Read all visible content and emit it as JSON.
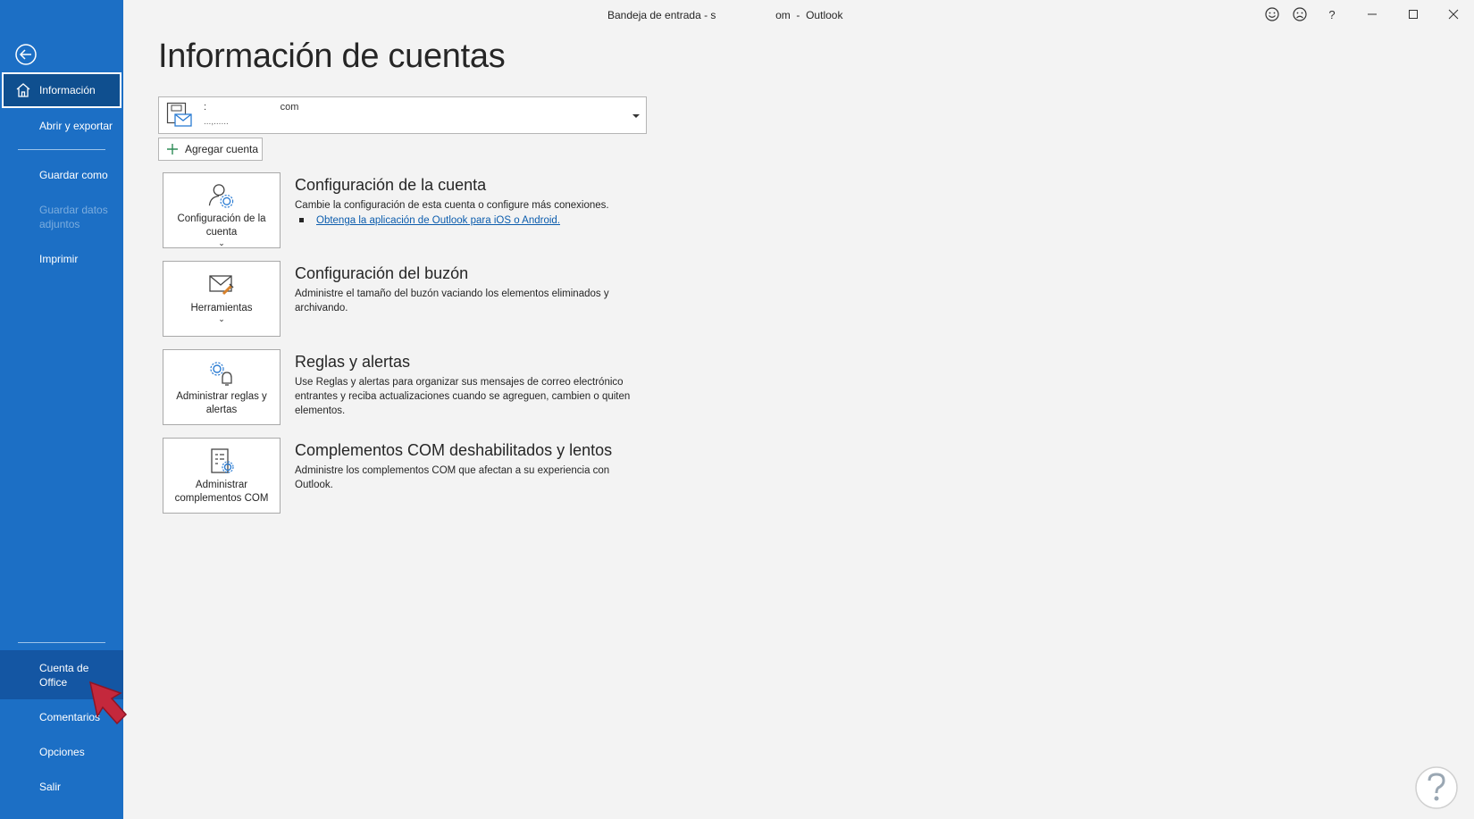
{
  "window": {
    "title": "Bandeja de entrada - s                    om  -  Outlook"
  },
  "sidebar": {
    "items": [
      {
        "label": "Información",
        "state": "active"
      },
      {
        "label": "Abrir y exportar"
      },
      {
        "label": "Guardar como"
      },
      {
        "label": "Guardar datos adjuntos",
        "state": "disabled"
      },
      {
        "label": "Imprimir"
      },
      {
        "label": "Cuenta de Office",
        "state": "highlight"
      },
      {
        "label": "Comentarios"
      },
      {
        "label": "Opciones"
      },
      {
        "label": "Salir"
      }
    ]
  },
  "main": {
    "title": "Información de cuentas",
    "account": {
      "email": ":                           com",
      "sub": "...,......"
    },
    "add_account_label": "Agregar cuenta",
    "sections": [
      {
        "tile_label": "Configuración de la cuenta",
        "title": "Configuración de la cuenta",
        "desc": "Cambie la configuración de esta cuenta o configure más conexiones.",
        "link": "Obtenga la aplicación de Outlook para iOS o Android."
      },
      {
        "tile_label": "Herramientas",
        "title": "Configuración del buzón",
        "desc": "Administre el tamaño del buzón vaciando los elementos eliminados y archivando."
      },
      {
        "tile_label": "Administrar reglas y alertas",
        "title": "Reglas y alertas",
        "desc": "Use Reglas y alertas para organizar sus mensajes de correo electrónico entrantes y reciba actualizaciones cuando se agreguen, cambien o quiten elementos."
      },
      {
        "tile_label": "Administrar complementos COM",
        "title": "Complementos COM deshabilitados y lentos",
        "desc": "Administre los complementos COM que afectan a su experiencia con Outlook."
      }
    ]
  },
  "colors": {
    "sidebar": "#1c6fc5",
    "active": "#0f4f8f",
    "link": "#0b5cad",
    "annotation_arrow": "#c4283c"
  }
}
